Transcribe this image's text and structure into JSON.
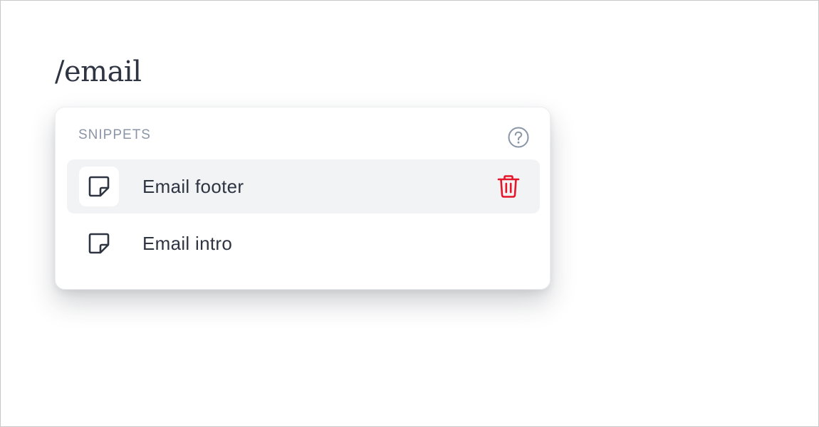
{
  "editor": {
    "text": "/email"
  },
  "popover": {
    "section_title": "SNIPPETS",
    "help_icon": "question-circle-icon",
    "items": [
      {
        "label": "Email footer",
        "icon": "note-icon",
        "active": true,
        "action_icon": "trash-icon"
      },
      {
        "label": "Email intro",
        "icon": "note-icon",
        "active": false
      }
    ]
  },
  "colors": {
    "text": "#2f3442",
    "muted": "#8a95a6",
    "active_row": "#f2f3f5",
    "delete": "#e5162a"
  }
}
